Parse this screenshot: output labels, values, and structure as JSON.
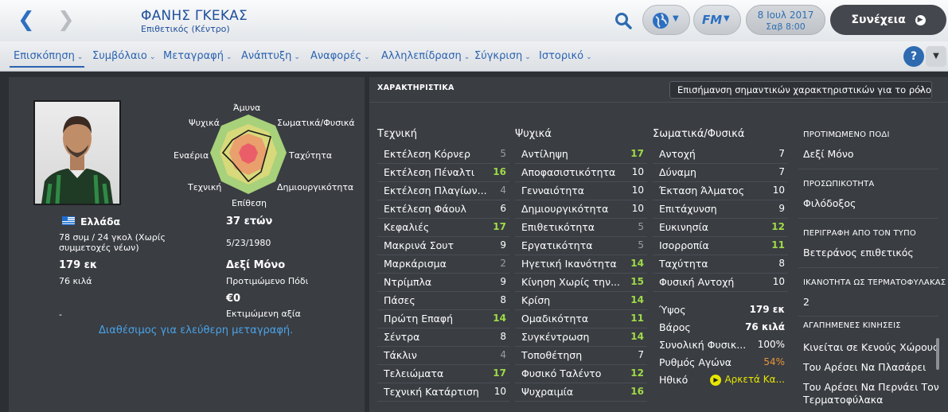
{
  "header": {
    "player_name": "ΦΑΝΗΣ ΓΚΕΚΑΣ",
    "player_role": "Επιθετικός (Κέντρο)",
    "date": "8 Ιουλ 2017",
    "time": "Σαβ 8:00",
    "continue_label": "Συνέχεια",
    "fm_label": "FM"
  },
  "tabs": [
    "Επισκόπηση",
    "Συμβόλαιο",
    "Μεταγραφή",
    "Ανάπτυξη",
    "Αναφορές",
    "Αλληλεπίδραση",
    "Σύγκριση",
    "Ιστορικό"
  ],
  "help_label": "?",
  "profile": {
    "nation": "Ελλάδα",
    "age": "37 ετών",
    "caps": "78 συμ / 24 γκολ (Χωρίς συμμετοχές νέων)",
    "dob": "5/23/1980",
    "height": "179 εκ",
    "weight": "76 κιλά",
    "foot_value": "Δεξί Μόνο",
    "foot_label": "Προτιμώμενο Πόδι",
    "value": "€0",
    "value_label": "Εκτιμώμενη αξία",
    "dash": "-",
    "availability": "Διαθέσιμος για ελεύθερη μεταγραφή."
  },
  "radar": {
    "labels": {
      "top": "Άμυνα",
      "top_left": "Ψυχικά",
      "top_right": "Σωματικά/Φυσικά",
      "left": "Εναέρια",
      "right": "Ταχύτητα",
      "bottom_left": "Τεχνική",
      "bottom_right": "Δημιουργικότητα",
      "bottom": "Επίθεση"
    }
  },
  "attributes": {
    "section_title": "ΧΑΡΑΚΤΗΡΙΣΤΙΚΑ",
    "highlight_select": "Επισήμανση σημαντικών χαρακτηριστικών για το ρόλο",
    "technical": {
      "title": "Τεχνική",
      "items": [
        {
          "name": "Εκτέλεση Κόρνερ",
          "value": "5"
        },
        {
          "name": "Εκτέλεση Πέναλτι",
          "value": "16"
        },
        {
          "name": "Εκτέλεση Πλαγίων...",
          "value": "4"
        },
        {
          "name": "Εκτέλεση Φάουλ",
          "value": "6"
        },
        {
          "name": "Κεφαλιές",
          "value": "17"
        },
        {
          "name": "Μακρινά Σουτ",
          "value": "9"
        },
        {
          "name": "Μαρκάρισμα",
          "value": "2"
        },
        {
          "name": "Ντρίμπλα",
          "value": "9"
        },
        {
          "name": "Πάσες",
          "value": "8"
        },
        {
          "name": "Πρώτη Επαφή",
          "value": "14"
        },
        {
          "name": "Σέντρα",
          "value": "8"
        },
        {
          "name": "Τάκλιν",
          "value": "4"
        },
        {
          "name": "Τελειώματα",
          "value": "17"
        },
        {
          "name": "Τεχνική Κατάρτιση",
          "value": "10"
        }
      ]
    },
    "mental": {
      "title": "Ψυχικά",
      "items": [
        {
          "name": "Αντίληψη",
          "value": "17"
        },
        {
          "name": "Αποφασιστικότητα",
          "value": "10"
        },
        {
          "name": "Γενναιότητα",
          "value": "10"
        },
        {
          "name": "Δημιουργικότητα",
          "value": "10"
        },
        {
          "name": "Επιθετικότητα",
          "value": "5"
        },
        {
          "name": "Εργατικότητα",
          "value": "5"
        },
        {
          "name": "Ηγετική Ικανότητα",
          "value": "14"
        },
        {
          "name": "Κίνηση Χωρίς την...",
          "value": "15"
        },
        {
          "name": "Κρίση",
          "value": "14"
        },
        {
          "name": "Ομαδικότητα",
          "value": "11"
        },
        {
          "name": "Συγκέντρωση",
          "value": "14"
        },
        {
          "name": "Τοποθέτηση",
          "value": "7"
        },
        {
          "name": "Φυσικό Ταλέντο",
          "value": "12"
        },
        {
          "name": "Ψυχραιμία",
          "value": "16"
        }
      ]
    },
    "physical": {
      "title": "Σωματικά/Φυσικά",
      "items": [
        {
          "name": "Αντοχή",
          "value": "7"
        },
        {
          "name": "Δύναμη",
          "value": "7"
        },
        {
          "name": "Έκταση Άλματος",
          "value": "10"
        },
        {
          "name": "Επιτάχυνση",
          "value": "9"
        },
        {
          "name": "Ευκινησία",
          "value": "12"
        },
        {
          "name": "Ισορροπία",
          "value": "11"
        },
        {
          "name": "Ταχύτητα",
          "value": "8"
        },
        {
          "name": "Φυσική Αντοχή",
          "value": "10"
        }
      ]
    },
    "stats": [
      {
        "name": "Ύψος",
        "value": "179 εκ"
      },
      {
        "name": "Βάρος",
        "value": "76 κιλά"
      },
      {
        "name": "Συνολική Φυσικ...",
        "value": "100%"
      },
      {
        "name": "Ρυθμός Αγώνα",
        "value": "54%"
      },
      {
        "name": "Ηθικό",
        "value": "Αρκετά Κα..."
      }
    ]
  },
  "info": {
    "foot_title": "ΠΡΟΤΙΜΩΜΕΝΟ ΠΟΔΙ",
    "foot_value": "Δεξί Μόνο",
    "personality_title": "ΠΡΟΣΩΠΙΚΟΤΗΤΑ",
    "personality_value": "Φιλόδοξος",
    "media_title": "ΠΕΡΙΓΡΑΦΗ ΑΠΟ ΤΟΝ ΤΥΠΟ",
    "media_value": "Βετεράνος επιθετικός",
    "gk_title": "ΙΚΑΝΟΤΗΤΑ ΩΣ ΤΕΡΜΑΤΟΦΥΛΑΚΑΣ",
    "gk_value": "2",
    "moves_title": "ΑΓΑΠΗΜΕΝΕΣ ΚΙΝΗΣΕΙΣ",
    "moves": [
      "Κινείται σε Κενούς Χώρους",
      "Του Αρέσει Να Πλασάρει",
      "Του Αρέσει Να Περνάει Τον",
      "Τερματοφύλακα"
    ]
  },
  "colors": {
    "accent": "#2b63b0",
    "green_value": "#9fda47",
    "orange_value": "#e8953a",
    "morale_icon": "#e6e600"
  }
}
